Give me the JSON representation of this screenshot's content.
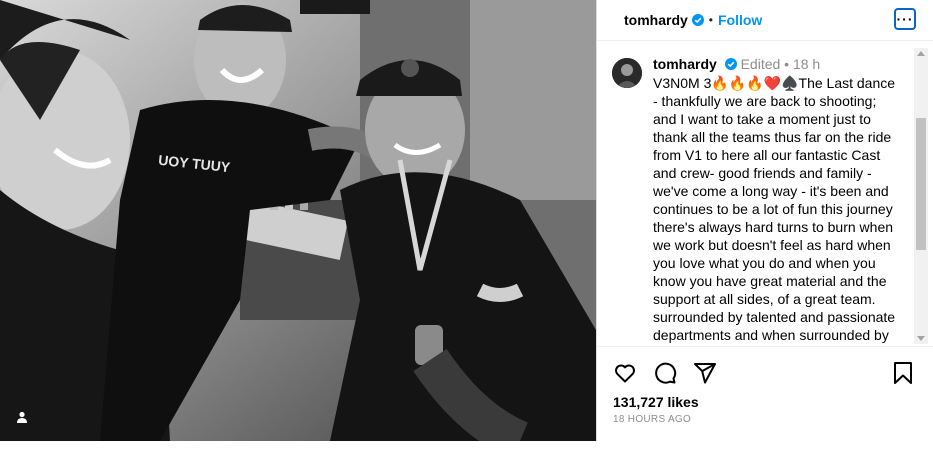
{
  "header": {
    "username": "tomhardy",
    "dot": "•",
    "follow_label": "Follow",
    "more_label": "···"
  },
  "caption": {
    "username": "tomhardy",
    "edited": "Edited",
    "dot": "•",
    "time": "18 h",
    "text": "V3N0M 3🔥🔥🔥❤️♠️The Last dance - thankfully we are back to shooting; and I want to take a moment just to thank all the teams thus far on the ride from V1 to here all our fantastic Cast and crew- good friends and family - we've come a long way - it's been and continues to be a lot of fun this journey there's always hard turns to burn when we work but doesn't feel as hard when you love what you do and when you know you have great material and the support at all sides, of a great team. surrounded by talented and passionate departments and when surrounded by"
  },
  "actions": {
    "likes": "131,727 likes",
    "time": "18 HOURS AGO"
  },
  "photo": {
    "shirt_text": "UOY TUUY"
  },
  "colors": {
    "accent": "#0095f6",
    "verified": "#0095f6",
    "muted": "#8e8e8e"
  },
  "icons": [
    "heart-icon",
    "comment-icon",
    "share-icon",
    "bookmark-icon",
    "user-tag-icon",
    "verified-icon",
    "more-icon"
  ]
}
